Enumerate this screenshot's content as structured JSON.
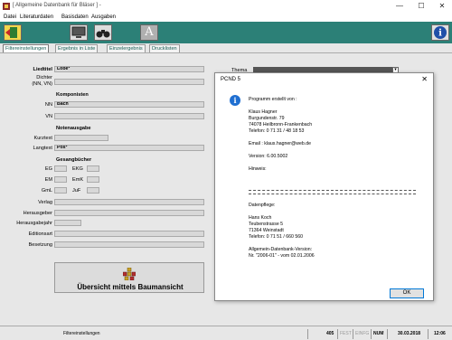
{
  "window": {
    "title": "[ Allgemeine Datenbank für Bläser ] -",
    "minimize": "—",
    "maximize": "☐",
    "close": "✕"
  },
  "menu": [
    "Datei",
    "Literaturdaten",
    "Basisdaten",
    "Ausgaben"
  ],
  "toolbar": {
    "icons": [
      "exit-icon",
      "monitor-icon",
      "binoculars-icon",
      "font-icon",
      "info-icon"
    ],
    "font_glyph": "A",
    "info_glyph": "i",
    "accent": "#2c8077"
  },
  "tabs": [
    "Filtereinstellungen",
    "Ergebnis in Liste",
    "Einzelergebnis",
    "Drucklisten"
  ],
  "form": {
    "liedtitel_label": "Liedtitel",
    "liedtitel_value": "Lobe*",
    "dichter_label": "Dichter\n(NN, VN)",
    "komponisten_heading": "Komponisten",
    "nn_label": "NN",
    "nn_value": "Bach",
    "vn_label": "VN",
    "notenausgabe_heading": "Notenausgabe",
    "kuerzel_label": "Kurztext",
    "langtext_label": "Langtext",
    "langtext_value": "Pos*",
    "gesangbuecher_heading": "Gesangbücher",
    "eg_label": "EG",
    "ekg_label": "EKG",
    "em_label": "EM",
    "emk_label": "EmK",
    "gml_label": "GmL",
    "juf_label": "JuF",
    "verlag_label": "Verlag",
    "herausgeber_label": "Herausgeber",
    "herausgabejahr_label": "Herausgabejahr",
    "editionsart_label": "Editionsart",
    "besetzung_label": "Besetzung",
    "thema_label": "Thema",
    "baum_button": "Übersicht mittels Baumansicht"
  },
  "dialog": {
    "title": "PCND 5",
    "close": "✕",
    "lines": [
      "Programm erstellt von :",
      "",
      "Klaus Hagner",
      "Burgundenstr. 79",
      "74078 Heilbronn-Frankenbach",
      "Telefon: 0 71 31 / 48 18 53",
      "",
      "Email : klaus.hagner@web.de",
      "",
      "Version: 6.00.5002",
      "",
      "Hinweis:"
    ],
    "lines2": [
      "Datenpflege:",
      "",
      "Hans Koch",
      "Teubenstrasse 5",
      "71364 Weinstadt",
      "Telefon: 0 71 51 / 660 560",
      "",
      "Allgemein-Datenbank-Version:",
      "Nr. \"2006-01\" - vom 02.01.2006"
    ],
    "ok": "OK"
  },
  "status": {
    "left": "Filtereinstellungen",
    "count": "405",
    "fest": "FEST",
    "einfg": "EINFG",
    "num": "NUM",
    "date": "30.03.2018",
    "time": "12:06"
  }
}
